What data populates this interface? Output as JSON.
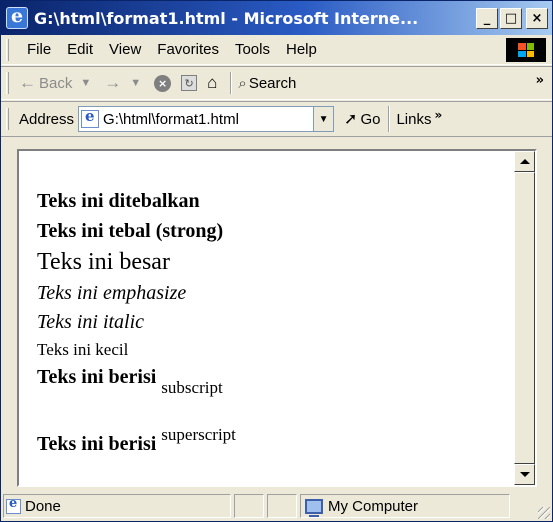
{
  "window": {
    "title": "G:\\html\\format1.html - Microsoft Interne...",
    "min_btn": "_",
    "max_btn": "□",
    "close_btn": "×"
  },
  "menu": {
    "items": [
      "File",
      "Edit",
      "View",
      "Favorites",
      "Tools",
      "Help"
    ]
  },
  "toolbar": {
    "back_label": "Back",
    "search_label": "Search",
    "overflow": "»"
  },
  "address": {
    "label": "Address",
    "value": "G:\\html\\format1.html",
    "go_label": "Go",
    "links_label": "Links",
    "links_overflow": "»"
  },
  "document": {
    "bold": "Teks ini ditebalkan",
    "strong": "Teks ini tebal (strong)",
    "big": "Teks ini besar",
    "emphasize": "Teks ini emphasize",
    "italic": "Teks ini italic",
    "small": "Teks ini kecil",
    "subscript_prefix": "Teks ini berisi",
    "subscript": "subscript",
    "superscript_prefix": "Teks ini berisi",
    "superscript": "superscript"
  },
  "status": {
    "text": "Done",
    "zone": "My Computer"
  },
  "colors": {
    "titlebar_start": "#0a246a",
    "titlebar_end": "#a6caf0",
    "chrome": "#ece9d8"
  }
}
